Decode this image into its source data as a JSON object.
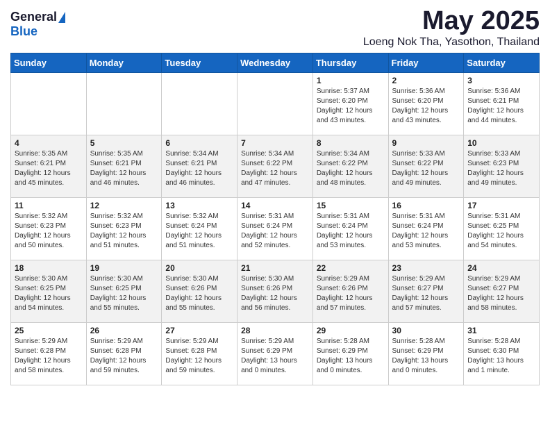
{
  "logo": {
    "general": "General",
    "blue": "Blue"
  },
  "title": "May 2025",
  "subtitle": "Loeng Nok Tha, Yasothon, Thailand",
  "weekdays": [
    "Sunday",
    "Monday",
    "Tuesday",
    "Wednesday",
    "Thursday",
    "Friday",
    "Saturday"
  ],
  "weeks": [
    [
      {
        "day": "",
        "info": ""
      },
      {
        "day": "",
        "info": ""
      },
      {
        "day": "",
        "info": ""
      },
      {
        "day": "",
        "info": ""
      },
      {
        "day": "1",
        "info": "Sunrise: 5:37 AM\nSunset: 6:20 PM\nDaylight: 12 hours\nand 43 minutes."
      },
      {
        "day": "2",
        "info": "Sunrise: 5:36 AM\nSunset: 6:20 PM\nDaylight: 12 hours\nand 43 minutes."
      },
      {
        "day": "3",
        "info": "Sunrise: 5:36 AM\nSunset: 6:21 PM\nDaylight: 12 hours\nand 44 minutes."
      }
    ],
    [
      {
        "day": "4",
        "info": "Sunrise: 5:35 AM\nSunset: 6:21 PM\nDaylight: 12 hours\nand 45 minutes."
      },
      {
        "day": "5",
        "info": "Sunrise: 5:35 AM\nSunset: 6:21 PM\nDaylight: 12 hours\nand 46 minutes."
      },
      {
        "day": "6",
        "info": "Sunrise: 5:34 AM\nSunset: 6:21 PM\nDaylight: 12 hours\nand 46 minutes."
      },
      {
        "day": "7",
        "info": "Sunrise: 5:34 AM\nSunset: 6:22 PM\nDaylight: 12 hours\nand 47 minutes."
      },
      {
        "day": "8",
        "info": "Sunrise: 5:34 AM\nSunset: 6:22 PM\nDaylight: 12 hours\nand 48 minutes."
      },
      {
        "day": "9",
        "info": "Sunrise: 5:33 AM\nSunset: 6:22 PM\nDaylight: 12 hours\nand 49 minutes."
      },
      {
        "day": "10",
        "info": "Sunrise: 5:33 AM\nSunset: 6:23 PM\nDaylight: 12 hours\nand 49 minutes."
      }
    ],
    [
      {
        "day": "11",
        "info": "Sunrise: 5:32 AM\nSunset: 6:23 PM\nDaylight: 12 hours\nand 50 minutes."
      },
      {
        "day": "12",
        "info": "Sunrise: 5:32 AM\nSunset: 6:23 PM\nDaylight: 12 hours\nand 51 minutes."
      },
      {
        "day": "13",
        "info": "Sunrise: 5:32 AM\nSunset: 6:24 PM\nDaylight: 12 hours\nand 51 minutes."
      },
      {
        "day": "14",
        "info": "Sunrise: 5:31 AM\nSunset: 6:24 PM\nDaylight: 12 hours\nand 52 minutes."
      },
      {
        "day": "15",
        "info": "Sunrise: 5:31 AM\nSunset: 6:24 PM\nDaylight: 12 hours\nand 53 minutes."
      },
      {
        "day": "16",
        "info": "Sunrise: 5:31 AM\nSunset: 6:24 PM\nDaylight: 12 hours\nand 53 minutes."
      },
      {
        "day": "17",
        "info": "Sunrise: 5:31 AM\nSunset: 6:25 PM\nDaylight: 12 hours\nand 54 minutes."
      }
    ],
    [
      {
        "day": "18",
        "info": "Sunrise: 5:30 AM\nSunset: 6:25 PM\nDaylight: 12 hours\nand 54 minutes."
      },
      {
        "day": "19",
        "info": "Sunrise: 5:30 AM\nSunset: 6:25 PM\nDaylight: 12 hours\nand 55 minutes."
      },
      {
        "day": "20",
        "info": "Sunrise: 5:30 AM\nSunset: 6:26 PM\nDaylight: 12 hours\nand 55 minutes."
      },
      {
        "day": "21",
        "info": "Sunrise: 5:30 AM\nSunset: 6:26 PM\nDaylight: 12 hours\nand 56 minutes."
      },
      {
        "day": "22",
        "info": "Sunrise: 5:29 AM\nSunset: 6:26 PM\nDaylight: 12 hours\nand 57 minutes."
      },
      {
        "day": "23",
        "info": "Sunrise: 5:29 AM\nSunset: 6:27 PM\nDaylight: 12 hours\nand 57 minutes."
      },
      {
        "day": "24",
        "info": "Sunrise: 5:29 AM\nSunset: 6:27 PM\nDaylight: 12 hours\nand 58 minutes."
      }
    ],
    [
      {
        "day": "25",
        "info": "Sunrise: 5:29 AM\nSunset: 6:28 PM\nDaylight: 12 hours\nand 58 minutes."
      },
      {
        "day": "26",
        "info": "Sunrise: 5:29 AM\nSunset: 6:28 PM\nDaylight: 12 hours\nand 59 minutes."
      },
      {
        "day": "27",
        "info": "Sunrise: 5:29 AM\nSunset: 6:28 PM\nDaylight: 12 hours\nand 59 minutes."
      },
      {
        "day": "28",
        "info": "Sunrise: 5:29 AM\nSunset: 6:29 PM\nDaylight: 13 hours\nand 0 minutes."
      },
      {
        "day": "29",
        "info": "Sunrise: 5:28 AM\nSunset: 6:29 PM\nDaylight: 13 hours\nand 0 minutes."
      },
      {
        "day": "30",
        "info": "Sunrise: 5:28 AM\nSunset: 6:29 PM\nDaylight: 13 hours\nand 0 minutes."
      },
      {
        "day": "31",
        "info": "Sunrise: 5:28 AM\nSunset: 6:30 PM\nDaylight: 13 hours\nand 1 minute."
      }
    ]
  ]
}
